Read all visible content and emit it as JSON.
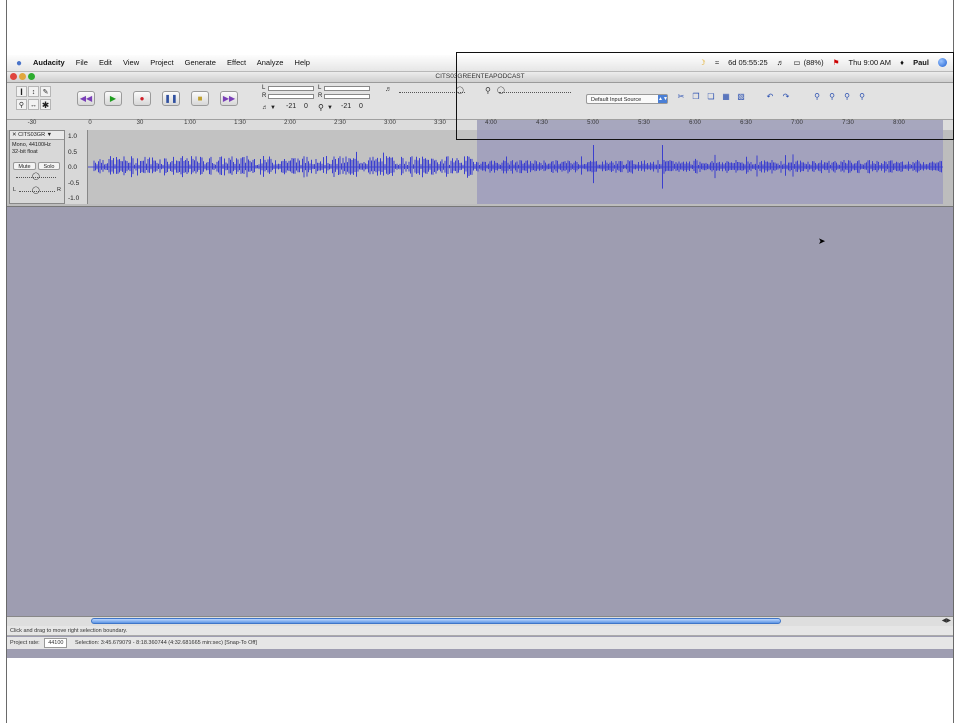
{
  "menubar": {
    "app_name": "Audacity",
    "menus": [
      "File",
      "Edit",
      "View",
      "Project",
      "Generate",
      "Effect",
      "Analyze",
      "Help"
    ],
    "status": {
      "battery_time": "6d 05:55:25",
      "battery_pct": "(88%)",
      "clock": "Thu 9:00 AM",
      "user": "Paul"
    }
  },
  "window": {
    "title": "CITS03GREENTEAPODCAST"
  },
  "toolbar": {
    "meter_play_db": "-21",
    "meter_play_zero": "0",
    "meter_rec_db": "-21",
    "meter_rec_zero": "0",
    "meter_L": "L",
    "meter_R": "R",
    "input_source": "Default Input Source"
  },
  "ruler": {
    "ticks": [
      "-30",
      "0",
      "30",
      "1:00",
      "1:30",
      "2:00",
      "2:30",
      "3:00",
      "3:30",
      "4:00",
      "4:30",
      "5:00",
      "5:30",
      "6:00",
      "6:30",
      "7:00",
      "7:30",
      "8:00"
    ]
  },
  "track": {
    "name": "CITS03GR",
    "info_line1": "Mono, 44100Hz",
    "info_line2": "32-bit float",
    "mute": "Mute",
    "solo": "Solo",
    "pan_L": "L",
    "pan_R": "R",
    "scale": [
      "1.0",
      "0.5",
      "0.0",
      "-0.5",
      "-1.0"
    ]
  },
  "status": {
    "message": "Click and drag to move right selection boundary.",
    "project_rate_label": "Project rate:",
    "project_rate": "44100",
    "selection": "Selection: 3:45.679079 - 8:18.360744 (4:32.681665 min:sec)   [Snap-To Off]"
  }
}
